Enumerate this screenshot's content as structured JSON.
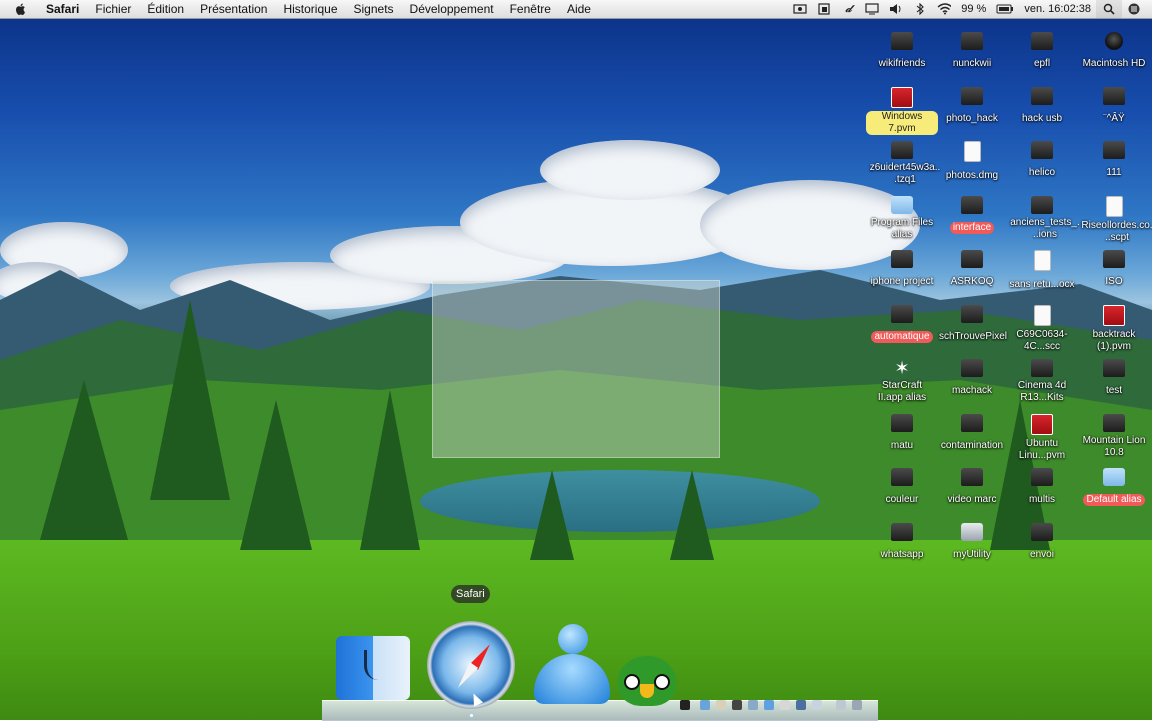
{
  "menubar": {
    "apple_icon": "apple-logo-icon",
    "app_name": "Safari",
    "items": [
      "Fichier",
      "Édition",
      "Présentation",
      "Historique",
      "Signets",
      "Développement",
      "Fenêtre",
      "Aide"
    ],
    "status_icons": [
      "screen-capture-icon",
      "window-icon",
      "script-icon",
      "display-icon",
      "volume-icon",
      "bluetooth-icon",
      "wifi-icon"
    ],
    "battery_text": "99 %",
    "clock": "ven. 16:02:38",
    "search_icon": "spotlight-search-icon",
    "menu_icon": "list-menu-icon"
  },
  "desktop": {
    "icons": [
      {
        "label": "wikifriends",
        "kind": "folder"
      },
      {
        "label": "nunckwii",
        "kind": "folder"
      },
      {
        "label": "epfl",
        "kind": "folder"
      },
      {
        "label": "Macintosh HD",
        "kind": "disk"
      },
      {
        "label": "Windows 7.pvm",
        "kind": "pvm",
        "tag": "yellow"
      },
      {
        "label": "photo_hack",
        "kind": "folder"
      },
      {
        "label": "hack usb",
        "kind": "folder"
      },
      {
        "label": "¨^ÂŸ",
        "kind": "folder"
      },
      {
        "label": "z6uidert45w3a...tzq1",
        "kind": "folder"
      },
      {
        "label": "photos.dmg",
        "kind": "doc"
      },
      {
        "label": "helico",
        "kind": "folder"
      },
      {
        "label": "111",
        "kind": "folder"
      },
      {
        "label": "Program Files alias",
        "kind": "bluefolder"
      },
      {
        "label": "interface",
        "kind": "folder",
        "tag": "red"
      },
      {
        "label": "anciens_tests_...ions",
        "kind": "folder"
      },
      {
        "label": "Riseollordes.co...scpt",
        "kind": "doc"
      },
      {
        "label": "iphone project",
        "kind": "folder"
      },
      {
        "label": "ASRKOQ",
        "kind": "folder"
      },
      {
        "label": "sans retu...ocx",
        "kind": "doc"
      },
      {
        "label": "ISO",
        "kind": "folder"
      },
      {
        "label": "automatique",
        "kind": "folder",
        "tag": "red"
      },
      {
        "label": "schTrouvePixel",
        "kind": "folder"
      },
      {
        "label": "C69C0634-4C...scc",
        "kind": "doc"
      },
      {
        "label": "backtrack (1).pvm",
        "kind": "pvm"
      },
      {
        "label": "StarCraft II.app alias",
        "kind": "star"
      },
      {
        "label": "machack",
        "kind": "folder"
      },
      {
        "label": "Cinema 4d R13...Kits",
        "kind": "folder"
      },
      {
        "label": "test",
        "kind": "folder"
      },
      {
        "label": "matu",
        "kind": "folder"
      },
      {
        "label": "contamination",
        "kind": "folder"
      },
      {
        "label": "Ubuntu Linu...pvm",
        "kind": "pvm"
      },
      {
        "label": "Mountain Lion 10.8",
        "kind": "folder"
      },
      {
        "label": "couleur",
        "kind": "folder"
      },
      {
        "label": "video marc",
        "kind": "folder"
      },
      {
        "label": "multis",
        "kind": "folder"
      },
      {
        "label": "Default alias",
        "kind": "bluefolder",
        "tag": "red"
      },
      {
        "label": "whatsapp",
        "kind": "folder"
      },
      {
        "label": "myUtility",
        "kind": "app"
      },
      {
        "label": "envoi",
        "kind": "folder"
      }
    ]
  },
  "dock": {
    "tooltip": "Safari",
    "apps": [
      {
        "icon": "finder-icon"
      },
      {
        "icon": "safari-compass-icon"
      },
      {
        "icon": "messenger-buddy-icon"
      },
      {
        "icon": "parrot-app-icon"
      }
    ]
  }
}
